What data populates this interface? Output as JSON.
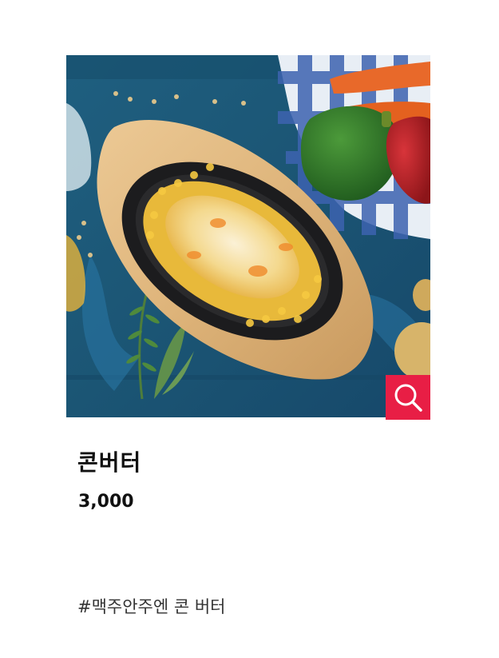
{
  "product": {
    "image_alt": "콘버터",
    "name": "콘버터",
    "price": "3,000",
    "tags": "#맥주안주엔 콘 버터"
  },
  "icons": {
    "zoom": "search-icon"
  },
  "colors": {
    "accent": "#e81e45",
    "background": "#ffffff",
    "text": "#111111",
    "tag_text": "#333333",
    "photo_table": "#1e5a7a"
  }
}
